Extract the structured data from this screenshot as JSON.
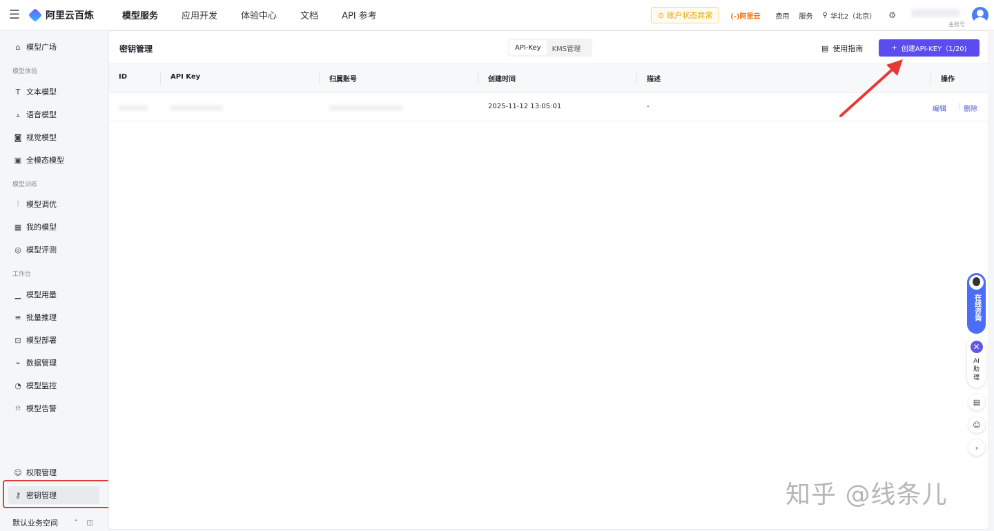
{
  "app": {
    "name": "阿里云百炼"
  },
  "topnav": {
    "tabs": [
      "模型服务",
      "应用开发",
      "体验中心",
      "文档",
      "API 参考"
    ],
    "warning": "账户状态异常",
    "aliyun": "(-)阿里云",
    "fee": "费用",
    "service": "服务",
    "region": "华北2（北京）",
    "account_sub": "主账号"
  },
  "sidebar": {
    "top_item": "模型广场",
    "group_experience": "模型体验",
    "experience": [
      "文本模型",
      "语音模型",
      "视觉模型",
      "全模态模型"
    ],
    "group_training": "模型训练",
    "training": [
      "模型调优",
      "我的模型",
      "模型评测"
    ],
    "group_workbench": "工作台",
    "workbench": [
      "模型用量",
      "批量推理",
      "模型部署",
      "数据管理",
      "模型监控",
      "模型告警"
    ],
    "permission": "权限管理",
    "key_mgmt": "密钥管理",
    "workspace": "默认业务空间"
  },
  "page": {
    "title": "密钥管理",
    "seg_api_key": "API-Key",
    "seg_kms": "KMS管理",
    "guide": "使用指南",
    "create_button": "创建API-KEY（1/20)"
  },
  "table": {
    "headers": {
      "id": "ID",
      "api_key": "API Key",
      "account": "归属账号",
      "created": "创建时间",
      "desc": "描述",
      "ops": "操作"
    },
    "rows": [
      {
        "created": "2025-11-12 13:05:01",
        "desc": "-",
        "edit": "编辑",
        "delete": "删除"
      }
    ]
  },
  "floating": {
    "consult": "在线咨询",
    "ai": "AI助理"
  },
  "watermark": "知乎 @线条儿",
  "colors": {
    "primary": "#5b4cf0",
    "link": "#4a5bd4",
    "warning": "#e8a200",
    "highlight": "#e53935"
  }
}
